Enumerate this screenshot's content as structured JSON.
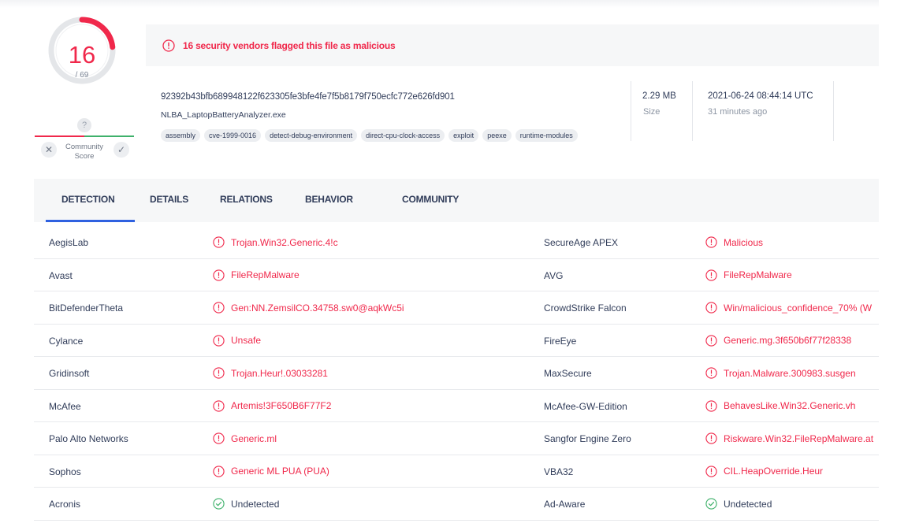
{
  "score": {
    "detected": "16",
    "total": "/ 69",
    "fraction": 0.232
  },
  "community": {
    "question": "?",
    "label": "Community Score",
    "dislike_icon": "x-icon",
    "like_icon": "check-icon"
  },
  "banner": {
    "text": "16 security vendors flagged this file as malicious",
    "icon": "alert-circle-icon"
  },
  "file": {
    "hash": "92392b43bfb689948122f623305fe3bfe4fe7f5b8179f750ecfc772e626fd901",
    "name": "NLBA_LaptopBatteryAnalyzer.exe",
    "tags": [
      "assembly",
      "cve-1999-0016",
      "detect-debug-environment",
      "direct-cpu-clock-access",
      "exploit",
      "peexe",
      "runtime-modules"
    ],
    "size_value": "2.29 MB",
    "size_label": "Size",
    "date_value": "2021-06-24 08:44:14 UTC",
    "date_label": "31 minutes ago"
  },
  "tabs": [
    "DETECTION",
    "DETAILS",
    "RELATIONS",
    "BEHAVIOR",
    "COMMUNITY"
  ],
  "detections": [
    [
      {
        "engine": "AegisLab",
        "result": "Trojan.Win32.Generic.4!c",
        "status": "malicious"
      },
      {
        "engine": "SecureAge APEX",
        "result": "Malicious",
        "status": "malicious"
      }
    ],
    [
      {
        "engine": "Avast",
        "result": "FileRepMalware",
        "status": "malicious"
      },
      {
        "engine": "AVG",
        "result": "FileRepMalware",
        "status": "malicious"
      }
    ],
    [
      {
        "engine": "BitDefenderTheta",
        "result": "Gen:NN.ZemsilCO.34758.sw0@aqkWc5i",
        "status": "malicious"
      },
      {
        "engine": "CrowdStrike Falcon",
        "result": "Win/malicious_confidence_70% (W",
        "status": "malicious"
      }
    ],
    [
      {
        "engine": "Cylance",
        "result": "Unsafe",
        "status": "malicious"
      },
      {
        "engine": "FireEye",
        "result": "Generic.mg.3f650b6f77f28338",
        "status": "malicious"
      }
    ],
    [
      {
        "engine": "Gridinsoft",
        "result": "Trojan.Heur!.03033281",
        "status": "malicious"
      },
      {
        "engine": "MaxSecure",
        "result": "Trojan.Malware.300983.susgen",
        "status": "malicious"
      }
    ],
    [
      {
        "engine": "McAfee",
        "result": "Artemis!3F650B6F77F2",
        "status": "malicious"
      },
      {
        "engine": "McAfee-GW-Edition",
        "result": "BehavesLike.Win32.Generic.vh",
        "status": "malicious"
      }
    ],
    [
      {
        "engine": "Palo Alto Networks",
        "result": "Generic.ml",
        "status": "malicious"
      },
      {
        "engine": "Sangfor Engine Zero",
        "result": "Riskware.Win32.FileRepMalware.at",
        "status": "malicious"
      }
    ],
    [
      {
        "engine": "Sophos",
        "result": "Generic ML PUA (PUA)",
        "status": "malicious"
      },
      {
        "engine": "VBA32",
        "result": "CIL.HeapOverride.Heur",
        "status": "malicious"
      }
    ],
    [
      {
        "engine": "Acronis",
        "result": "Undetected",
        "status": "undetected"
      },
      {
        "engine": "Ad-Aware",
        "result": "Undetected",
        "status": "undetected"
      }
    ]
  ],
  "colors": {
    "danger": "#f0284b",
    "safe": "#3fb16b",
    "accent": "#2f61e0",
    "text": "#313d5a"
  },
  "icons": {
    "malicious": "alert-circle-icon",
    "undetected": "check-circle-icon"
  }
}
